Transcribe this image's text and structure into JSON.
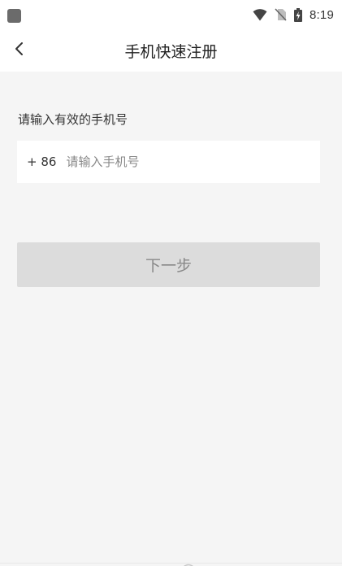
{
  "status_bar": {
    "time": "8:19",
    "icons": [
      "wifi-icon",
      "no-sim-icon",
      "battery-charging-icon"
    ]
  },
  "nav": {
    "back_icon": "chevron-left-icon",
    "title": "手机快速注册"
  },
  "form": {
    "phone_prompt": "请输入有效的手机号",
    "country_code": "+ 86",
    "phone_placeholder": "请输入手机号",
    "next_label": "下一步"
  },
  "colors": {
    "background": "#f5f5f5",
    "surface": "#ffffff",
    "button_disabled_bg": "#dcdcdc",
    "button_disabled_text": "#888888"
  }
}
